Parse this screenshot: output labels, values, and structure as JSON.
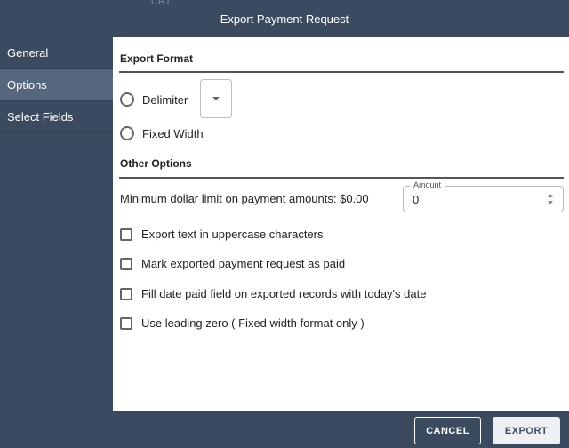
{
  "dialog": {
    "title": "Export Payment Request",
    "background_hint": "CRT..."
  },
  "sidebar": {
    "items": [
      {
        "label": "General",
        "active": false
      },
      {
        "label": "Options",
        "active": true
      },
      {
        "label": "Select Fields",
        "active": false
      }
    ]
  },
  "export_format": {
    "title": "Export Format",
    "options": [
      {
        "label": "Delimiter",
        "checked": false
      },
      {
        "label": "Fixed Width",
        "checked": false
      }
    ]
  },
  "other_options": {
    "title": "Other Options",
    "min_label": "Minimum dollar limit on payment amounts: $0.00",
    "amount_legend": "Amount",
    "amount_value": "0",
    "checkboxes": [
      {
        "label": "Export text in uppercase characters",
        "checked": false
      },
      {
        "label": "Mark exported payment request as paid",
        "checked": false
      },
      {
        "label": "Fill date paid field on exported records with today's date",
        "checked": false
      },
      {
        "label": "Use leading zero ( Fixed width format only )",
        "checked": false
      }
    ]
  },
  "footer": {
    "cancel_label": "CANCEL",
    "export_label": "EXPORT"
  },
  "colors": {
    "header_bg": "#3b4a5e",
    "active_nav": "#56677d",
    "content_bg": "#ffffff"
  }
}
